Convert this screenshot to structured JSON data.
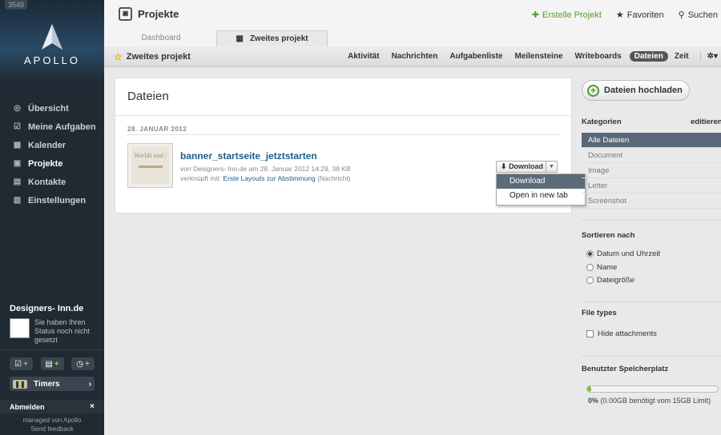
{
  "sidebar": {
    "badge": "3549",
    "logo_text": "APOLLO",
    "nav": [
      {
        "label": "Übersicht",
        "icon": "overview-icon",
        "glyph": "◎"
      },
      {
        "label": "Meine Aufgaben",
        "icon": "checkbox-icon",
        "glyph": "☑"
      },
      {
        "label": "Kalender",
        "icon": "calendar-icon",
        "glyph": "▦"
      },
      {
        "label": "Projekte",
        "icon": "projects-icon",
        "glyph": "▣"
      },
      {
        "label": "Kontakte",
        "icon": "contacts-icon",
        "glyph": "▤"
      },
      {
        "label": "Einstellungen",
        "icon": "settings-icon",
        "glyph": "▥"
      }
    ],
    "active_nav": "Projekte",
    "user": {
      "name": "Designers- Inn.de",
      "status": "Sie haben Ihren Status noch nicht gesetzt"
    },
    "timers_label": "Timers",
    "logout_label": "Abmelden",
    "footer_line1": "managed von Apollo",
    "footer_line2": "Send feedback"
  },
  "header": {
    "title": "Projekte",
    "create_project": "Erstelle Projekt",
    "favorites": "Favoriten",
    "search": "Suchen"
  },
  "tabs": [
    "Dashboard",
    "Zweites projekt"
  ],
  "subnav": {
    "project_name": "Zweites projekt",
    "items": [
      "Aktivität",
      "Nachrichten",
      "Aufgabenliste",
      "Meilensteine",
      "Writeboards",
      "Dateien",
      "Zeit"
    ],
    "active": "Dateien"
  },
  "main": {
    "title": "Dateien",
    "date_label": "28. JANUAR 2012",
    "file": {
      "name": "banner_startseite_jetztstarten",
      "meta": "von Designers- Inn.de am 28. Januar 2012 14:29, 38 KB",
      "linked_prefix": "verknüpft mit:",
      "linked_link": "Erste Layouts zur Abstimmung",
      "linked_suffix": "(Nachricht)",
      "thumb_text": "Worlds und /"
    },
    "download_label": "Download",
    "dropdown": [
      "Download",
      "Open in new tab"
    ]
  },
  "right": {
    "upload_label": "Dateien hochladen",
    "categories_title": "Kategorien",
    "categories_edit": "editieren",
    "categories": [
      "Alle Dateien",
      "Document",
      "Image",
      "Letter",
      "Screenshot"
    ],
    "sort_title": "Sortieren nach",
    "sort_options": [
      "Datum und Uhrzeit",
      "Name",
      "Dateigröße"
    ],
    "sort_selected": "Datum und Uhrzeit",
    "filetypes_title": "File types",
    "hide_attachments": "Hide attachments",
    "storage_title": "Benutzter Speicherplatz",
    "storage_percent": "0%",
    "storage_detail": "(0.00GB benötigt vom 15GB Limit)",
    "storage_fraction": 0.0
  },
  "colors": {
    "accent_green": "#5a9b2d",
    "link_blue": "#1d5e8a",
    "sidebar_bg": "#1f2a33",
    "selected_row": "#596878"
  }
}
